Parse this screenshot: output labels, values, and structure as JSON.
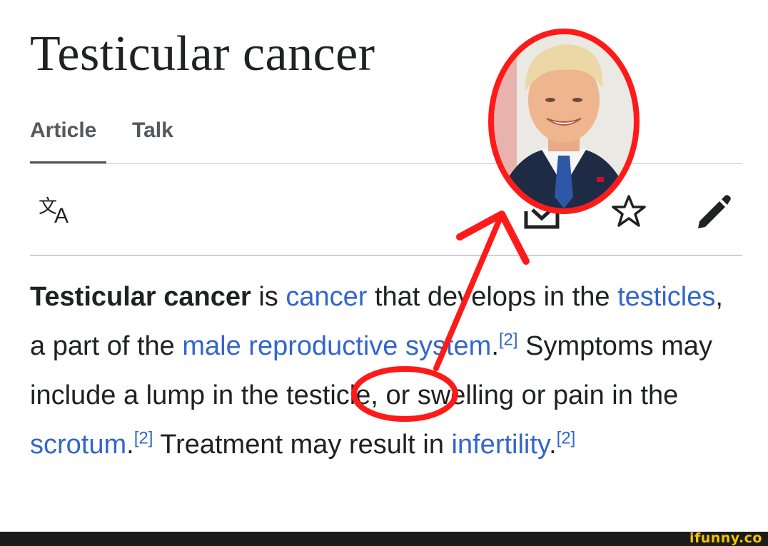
{
  "page": {
    "title": "Testicular cancer"
  },
  "tabs": [
    {
      "label": "Article",
      "selected": true
    },
    {
      "label": "Talk",
      "selected": false
    }
  ],
  "toolbar": {
    "icons": [
      "translate-icon",
      "download-icon",
      "star-icon",
      "edit-icon"
    ],
    "translate_glyph": "文A"
  },
  "article": {
    "bold_term": "Testicular cancer",
    "t1": " is ",
    "link_cancer": "cancer",
    "t2": " that develops in the ",
    "link_testicles": "testicles",
    "t3": ", a part of the ",
    "link_reproductive": "male reproductive system",
    "t4": ".",
    "ref1": "[2]",
    "t5": " Symptoms may include a lump in the testicle, or swelling or pain in the ",
    "link_scrotum": "scrotum",
    "t6": ".",
    "ref2": "[2]",
    "t7": " Treatment may result in ",
    "link_infertility": "infertility",
    "t8": ".",
    "ref3": "[2]"
  },
  "colors": {
    "link": "#3366cc",
    "text": "#202122",
    "annotation": "#ff1a1a",
    "watermark": "#f5c400"
  },
  "watermark": {
    "text": "ifunny.co"
  }
}
